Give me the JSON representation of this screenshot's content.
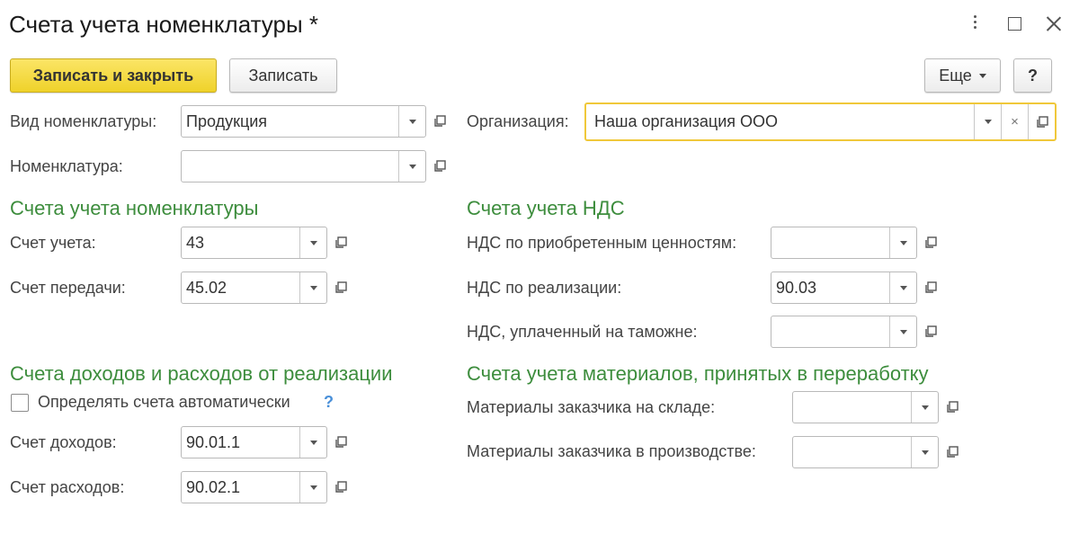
{
  "window": {
    "title": "Счета учета номенклатуры *"
  },
  "toolbar": {
    "save_close_label": "Записать и закрыть",
    "save_label": "Записать",
    "more_label": "Еще",
    "help_label": "?"
  },
  "header_fields": {
    "vid_label": "Вид номенклатуры:",
    "vid_value": "Продукция",
    "org_label": "Организация:",
    "org_value": "Наша организация ООО",
    "nomenclature_label": "Номенклатура:",
    "nomenclature_value": ""
  },
  "sections": {
    "nomenclature_accounts": {
      "title": "Счета учета номенклатуры",
      "account_label": "Счет учета:",
      "account_value": "43",
      "transfer_label": "Счет передачи:",
      "transfer_value": "45.02"
    },
    "vat_accounts": {
      "title": "Счета учета НДС",
      "purchased_label": "НДС по приобретенным ценностям:",
      "purchased_value": "",
      "sales_label": "НДС по реализации:",
      "sales_value": "90.03",
      "customs_label": "НДС, уплаченный на таможне:",
      "customs_value": ""
    },
    "income_expense": {
      "title": "Счета доходов и расходов от реализации",
      "auto_checkbox_label": "Определять счета автоматически",
      "auto_checked": false,
      "help_mark": "?",
      "income_label": "Счет доходов:",
      "income_value": "90.01.1",
      "expense_label": "Счет расходов:",
      "expense_value": "90.02.1"
    },
    "materials": {
      "title": "Счета учета материалов, принятых в переработку",
      "warehouse_label": "Материалы заказчика на складе:",
      "warehouse_value": "",
      "production_label": "Материалы заказчика в производстве:",
      "production_value": ""
    }
  },
  "icons": {
    "clear": "×",
    "kebab": "more-vert-icon",
    "maximize": "maximize-icon",
    "close": "close-icon",
    "open": "open-form-icon",
    "dropdown": "chevron-down-icon"
  },
  "colors": {
    "section_title": "#3d8d3d",
    "primary_button": "#f4d935",
    "highlight_border": "#f0c83a",
    "help_mark": "#4a90d9"
  }
}
